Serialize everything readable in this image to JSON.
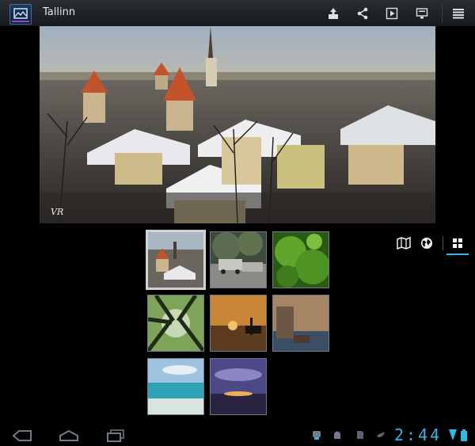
{
  "action_bar": {
    "title": "Tallinn",
    "icons": [
      "gallery-app-icon",
      "share-upload-icon",
      "share-icon",
      "slideshow-icon",
      "details-icon",
      "menu-icon"
    ]
  },
  "hero": {
    "signature": "VR"
  },
  "view_switch": {
    "icons": [
      "map-icon",
      "globe-icon",
      "grid-view-icon"
    ],
    "active": "grid-view-icon"
  },
  "thumbnails": [
    {
      "scene": "town",
      "selected": true
    },
    {
      "scene": "cars",
      "selected": false
    },
    {
      "scene": "moss",
      "selected": false
    },
    {
      "scene": "forest",
      "selected": false
    },
    {
      "scene": "sunset-ship",
      "selected": false
    },
    {
      "scene": "tower",
      "selected": false
    },
    {
      "scene": "beach",
      "selected": false
    },
    {
      "scene": "purple-sky",
      "selected": false
    }
  ],
  "status_bar": {
    "time": "2:44",
    "icons": [
      "back-icon",
      "home-icon",
      "recent-apps-icon",
      "usb-debug-icon",
      "android-icon",
      "sd-card-icon",
      "twitter-icon",
      "wifi-icon",
      "battery-icon"
    ]
  },
  "colors": {
    "accent": "#33b5e5",
    "background": "#000000"
  }
}
